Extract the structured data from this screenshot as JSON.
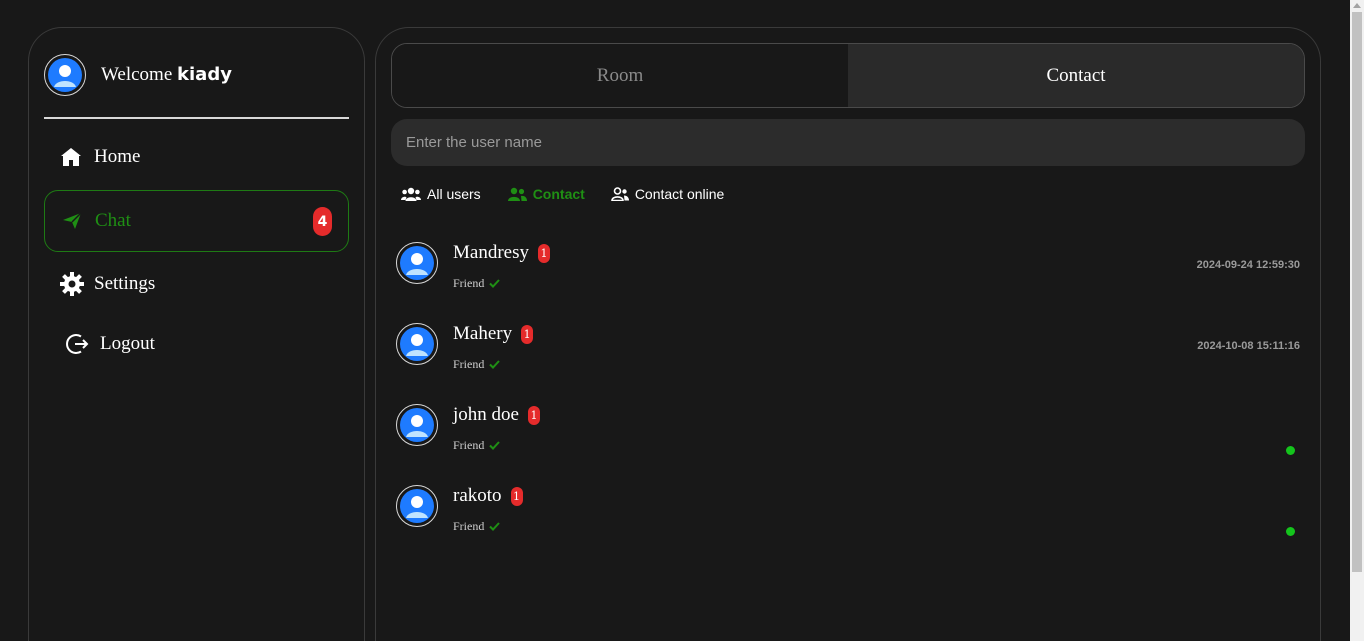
{
  "sidebar": {
    "welcome_text": "Welcome",
    "username": "kiady",
    "nav": [
      {
        "label": "Home",
        "icon": "home-icon"
      },
      {
        "label": "Chat",
        "icon": "send-icon",
        "badge": "4",
        "active": true
      },
      {
        "label": "Settings",
        "icon": "gear-icon"
      },
      {
        "label": "Logout",
        "icon": "logout-icon"
      }
    ]
  },
  "main": {
    "tabs": [
      {
        "label": "Room",
        "active": false
      },
      {
        "label": "Contact",
        "active": true
      }
    ],
    "search": {
      "placeholder": "Enter the user name",
      "value": ""
    },
    "filters": [
      {
        "label": "All users",
        "icon": "users-icon"
      },
      {
        "label": "Contact",
        "icon": "contact-group-icon",
        "active": true
      },
      {
        "label": "Contact online",
        "icon": "user-check-icon"
      }
    ],
    "contacts": [
      {
        "name": "Mandresy",
        "unread": "1",
        "status": "Friend",
        "last_seen": "2024-09-24 12:59:30",
        "online": false
      },
      {
        "name": "Mahery",
        "unread": "1",
        "status": "Friend",
        "last_seen": "2024-10-08 15:11:16",
        "online": false
      },
      {
        "name": "john doe",
        "unread": "1",
        "status": "Friend",
        "last_seen": "",
        "online": true
      },
      {
        "name": "rakoto",
        "unread": "1",
        "status": "Friend",
        "last_seen": "",
        "online": true
      }
    ]
  },
  "colors": {
    "background": "#181818",
    "accent_green": "#1f8f14",
    "badge_red": "#e52b2b",
    "online_green": "#14c41c",
    "avatar_blue": "#1e7bff"
  }
}
